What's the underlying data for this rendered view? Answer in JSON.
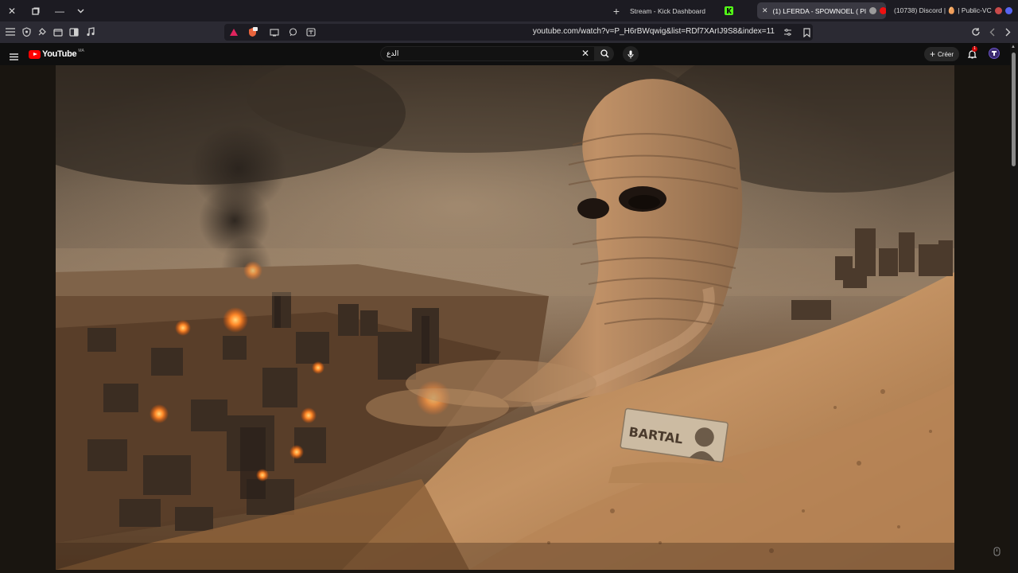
{
  "browser": {
    "tabs": [
      {
        "title": "Stream - Kick Dashboard",
        "favicon": "kick-icon",
        "active": false
      },
      {
        "title": "(1) LFERDA - SPOWNOEL ( Pl",
        "favicon": "youtube-icon",
        "active": true
      },
      {
        "title": "(10738) Discord | 🥚 | Public-VC",
        "favicon": "discord-icon",
        "active": false
      }
    ],
    "new_tab_label": "+",
    "url": "youtube.com/watch?v=P_H6rBWqwig&list=RDf7XArIJ9S8&index=11"
  },
  "youtube": {
    "logo_text": "YouTube",
    "country_code": "MA",
    "search_value": "الدع",
    "create_label": "Créer",
    "notification_count": "1"
  },
  "video": {
    "sign_text": "BARTAL",
    "scene_description_icon": "sandstorm-thumbnail"
  },
  "colors": {
    "tab_strip": "#1c1b22",
    "toolbar": "#2b2a33",
    "youtube_red": "#ff0000",
    "kick_green": "#53fc18",
    "sand": "#b98655"
  }
}
